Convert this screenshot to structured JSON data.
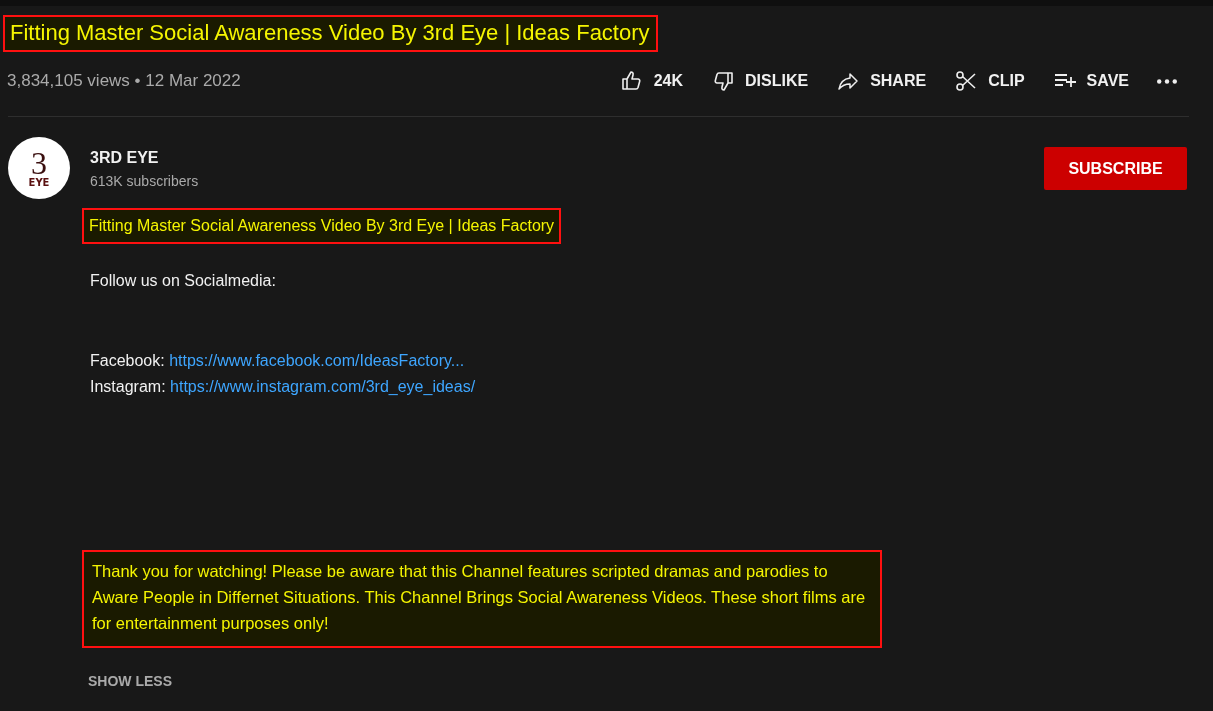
{
  "title": {
    "text": "Fitting Master Social Awareness Video By 3rd Eye | Ideas Factory",
    "highlighted": true
  },
  "meta": "3,834,105 views • 12 Mar 2022",
  "actions": [
    {
      "kind": "like",
      "label": "24K"
    },
    {
      "kind": "dislike",
      "label": "DISLIKE"
    },
    {
      "kind": "share",
      "label": "SHARE"
    },
    {
      "kind": "clip",
      "label": "CLIP"
    },
    {
      "kind": "save",
      "label": "SAVE"
    },
    {
      "kind": "more"
    }
  ],
  "channel": {
    "name": "3RD EYE",
    "subscribers": "613K subscribers",
    "logo_number": "3",
    "logo_word": "EYE"
  },
  "subscribe": "SUBSCRIBE",
  "description": [
    {
      "kind": "text",
      "text": "Fitting Master Social Awareness Video By 3rd Eye | Ideas Factory",
      "highlighted": true
    },
    {
      "kind": "text",
      "text": "Follow us on Socialmedia:",
      "highlighted": false
    },
    {
      "kind": "links",
      "items": [
        {
          "label": "Facebook:",
          "url": "https://www.facebook.com/IdeasFactory..."
        },
        {
          "label": "Instagram:",
          "url": "https://www.instagram.com/3rd_eye_ideas/"
        }
      ]
    },
    {
      "kind": "text",
      "text": "Thank you for watching! Please be aware that this Channel features scripted dramas and parodies to Aware People in Differnet Situations. This Channel Brings Social Awareness Videos. These short films are for entertainment purposes only!",
      "highlighted": true
    }
  ],
  "show_less": "SHOW LESS"
}
